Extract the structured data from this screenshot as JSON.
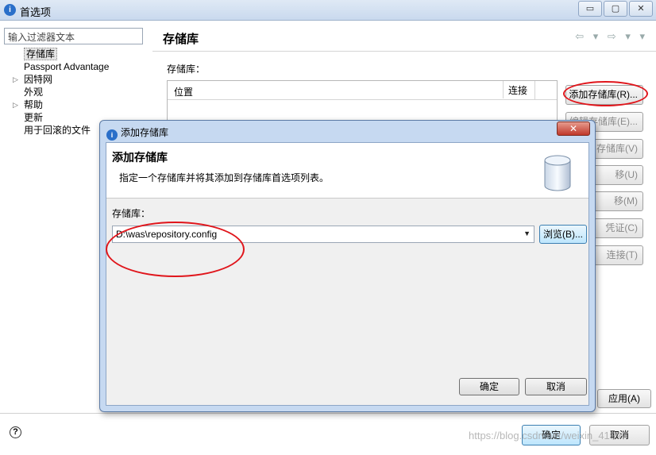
{
  "window": {
    "title": "首选项",
    "controls": [
      "▭",
      "▢",
      "✕"
    ]
  },
  "left": {
    "filter_placeholder": "输入过滤器文本",
    "tree": [
      {
        "label": "存储库",
        "selected": true,
        "expandable": false
      },
      {
        "label": "Passport Advantage",
        "selected": false,
        "expandable": false
      },
      {
        "label": "因特网",
        "selected": false,
        "expandable": true
      },
      {
        "label": "外观",
        "selected": false,
        "expandable": false
      },
      {
        "label": "帮助",
        "selected": false,
        "expandable": true
      },
      {
        "label": "更新",
        "selected": false,
        "expandable": false
      },
      {
        "label": "用于回滚的文件",
        "selected": false,
        "expandable": false
      }
    ]
  },
  "main": {
    "title": "存储库",
    "nav": "⇦ ▾ ⇨ ▾ ▾",
    "section_label": "存储库：",
    "columns": {
      "location": "位置",
      "connection": "连接"
    },
    "buttons": [
      {
        "label": "添加存储库(R)...",
        "enabled": true
      },
      {
        "label": "编辑存储库(E)...",
        "enabled": false
      },
      {
        "label": "存储库(V)",
        "enabled": false
      },
      {
        "label": "移(U)",
        "enabled": false
      },
      {
        "label": "移(M)",
        "enabled": false
      },
      {
        "label": "凭证(C)",
        "enabled": false
      },
      {
        "label": "连接(T)",
        "enabled": false
      }
    ],
    "apply_label": "应用(A)"
  },
  "footer": {
    "help": "?",
    "ok_label": "确定",
    "cancel_label": "取消",
    "watermark": "https://blog.csdn.net/weixin_41997"
  },
  "dialog": {
    "title": "添加存储库",
    "close": "✕",
    "heading": "添加存储库",
    "description": "指定一个存储库并将其添加到存储库首选项列表。",
    "field_label": "存储库：",
    "field_value": "D:\\was\\repository.config",
    "browse_label": "浏览(B)...",
    "ok_label": "确定",
    "cancel_label": "取消"
  },
  "colors": {
    "annotation": "#e0151b",
    "accent": "#2a6fc9"
  }
}
